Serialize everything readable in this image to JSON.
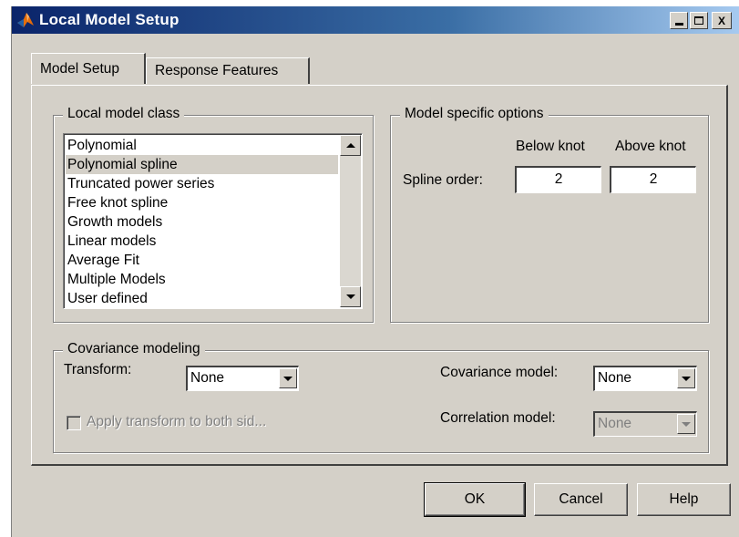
{
  "window": {
    "title": "Local Model Setup",
    "minimize_label": "",
    "maximize_label": "",
    "close_label": "X"
  },
  "tabs": [
    {
      "label": "Model Setup",
      "active": true
    },
    {
      "label": "Response Features",
      "active": false
    }
  ],
  "local_model_class": {
    "title": "Local model class",
    "items": [
      "Polynomial",
      "Polynomial spline",
      "Truncated power series",
      "Free knot spline",
      "Growth models",
      "Linear models",
      "Average Fit",
      "Multiple Models",
      "User defined"
    ],
    "selected": "Polynomial spline"
  },
  "model_options": {
    "title": "Model specific options",
    "below_knot_label": "Below knot",
    "above_knot_label": "Above knot",
    "spline_order_label": "Spline order:",
    "below_knot_value": "2",
    "above_knot_value": "2"
  },
  "covariance": {
    "title": "Covariance modeling",
    "transform_label": "Transform:",
    "transform_value": "None",
    "apply_label": "Apply transform to both sid...",
    "apply_checked": false,
    "covariance_model_label": "Covariance model:",
    "covariance_model_value": "None",
    "correlation_model_label": "Correlation model:",
    "correlation_model_value": "None"
  },
  "buttons": {
    "ok": "OK",
    "cancel": "Cancel",
    "help": "Help"
  },
  "colors": {
    "face": "#d4d0c8",
    "title_start": "#0a246a",
    "title_end": "#a6caf0"
  }
}
